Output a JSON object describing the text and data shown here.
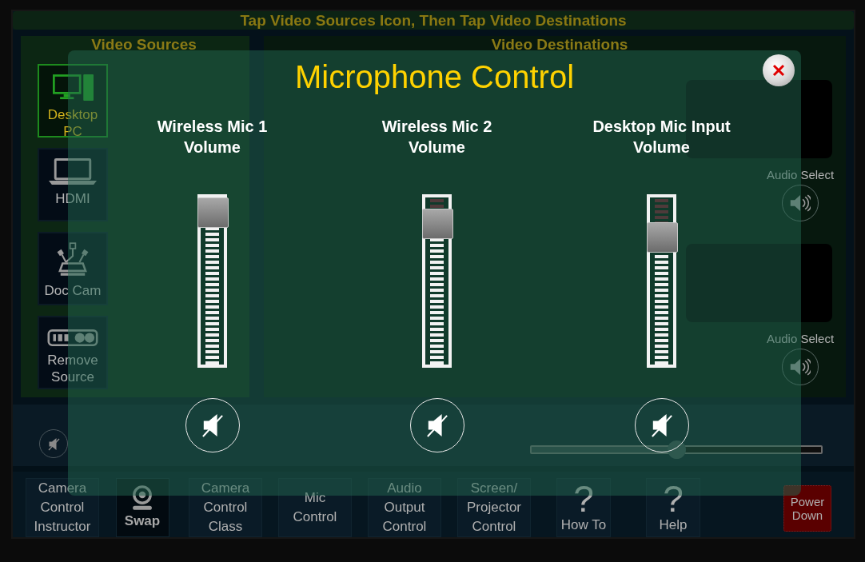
{
  "banner": {
    "text": "Tap Video Sources Icon, Then Tap Video Destinations"
  },
  "video_sources": {
    "title": "Video Sources",
    "items": [
      {
        "label": "Desktop PC",
        "kind": "computer",
        "selected": true
      },
      {
        "label": "HDMI",
        "kind": "laptop",
        "selected": false
      },
      {
        "label": "Doc Cam",
        "kind": "document-camera",
        "selected": false
      },
      {
        "label": "Remove Source",
        "kind": "keypad",
        "selected": false
      }
    ]
  },
  "video_destinations": {
    "title": "Video Destinations",
    "outputs": [
      {
        "audio_select_label": "Audio Select",
        "audio_selected": false
      },
      {
        "audio_select_label": "Audio Select",
        "audio_selected": false
      }
    ]
  },
  "volume_slider": {
    "level": 0.5
  },
  "nav_buttons": [
    {
      "kind": "text",
      "label": "Camera Control Instructor"
    },
    {
      "kind": "webcam",
      "label": "Swap"
    },
    {
      "kind": "text",
      "label": "Camera Control Class"
    },
    {
      "kind": "text",
      "label": "Mic Control"
    },
    {
      "kind": "text",
      "label": "Audio Output Control"
    },
    {
      "kind": "text",
      "label": "Screen/ Projector Control"
    },
    {
      "kind": "glyph",
      "glyph": "?",
      "label": "How To"
    },
    {
      "kind": "glyph",
      "glyph": "?",
      "label": "Help"
    },
    {
      "kind": "power",
      "label": "Power Down"
    }
  ],
  "dialog": {
    "title": "Microphone Control",
    "channels": [
      {
        "name": "Wireless Mic 1 Volume",
        "level": 1
      },
      {
        "name": "Wireless Mic 2 Volume",
        "level": 0.92
      },
      {
        "name": "Desktop Mic Input Volume",
        "level": 0.82
      }
    ]
  }
}
